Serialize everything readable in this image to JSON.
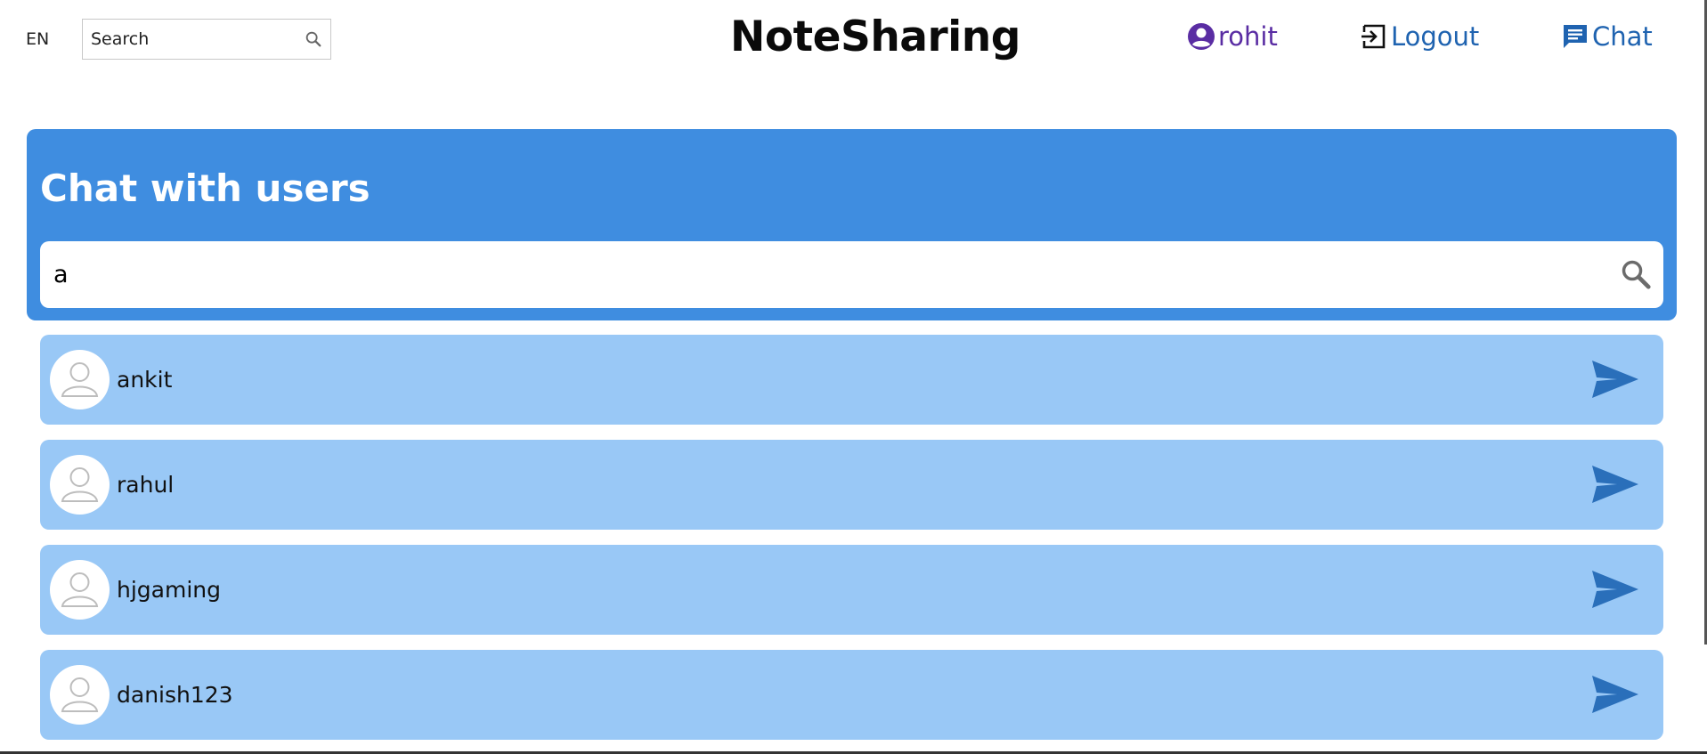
{
  "header": {
    "language": "EN",
    "search_placeholder": "Search",
    "brand": "NoteSharing",
    "user_label": "rohit",
    "logout_label": "Logout",
    "chat_label": "Chat"
  },
  "chat_panel": {
    "title": "Chat with users",
    "search_value": "a"
  },
  "users": [
    {
      "name": "ankit"
    },
    {
      "name": "rahul"
    },
    {
      "name": "hjgaming"
    },
    {
      "name": "danish123"
    }
  ],
  "colors": {
    "panel_blue": "#3f8de0",
    "row_blue": "#99c8f6",
    "send_blue": "#2a6fba",
    "user_purple": "#5a2da3",
    "link_blue": "#1f63b0"
  },
  "icons": {
    "nav_search": "search-icon",
    "user": "account-circle-icon",
    "logout": "logout-icon",
    "chat": "chat-icon",
    "panel_search": "search-icon",
    "avatar": "user-avatar-icon",
    "send": "send-icon"
  }
}
